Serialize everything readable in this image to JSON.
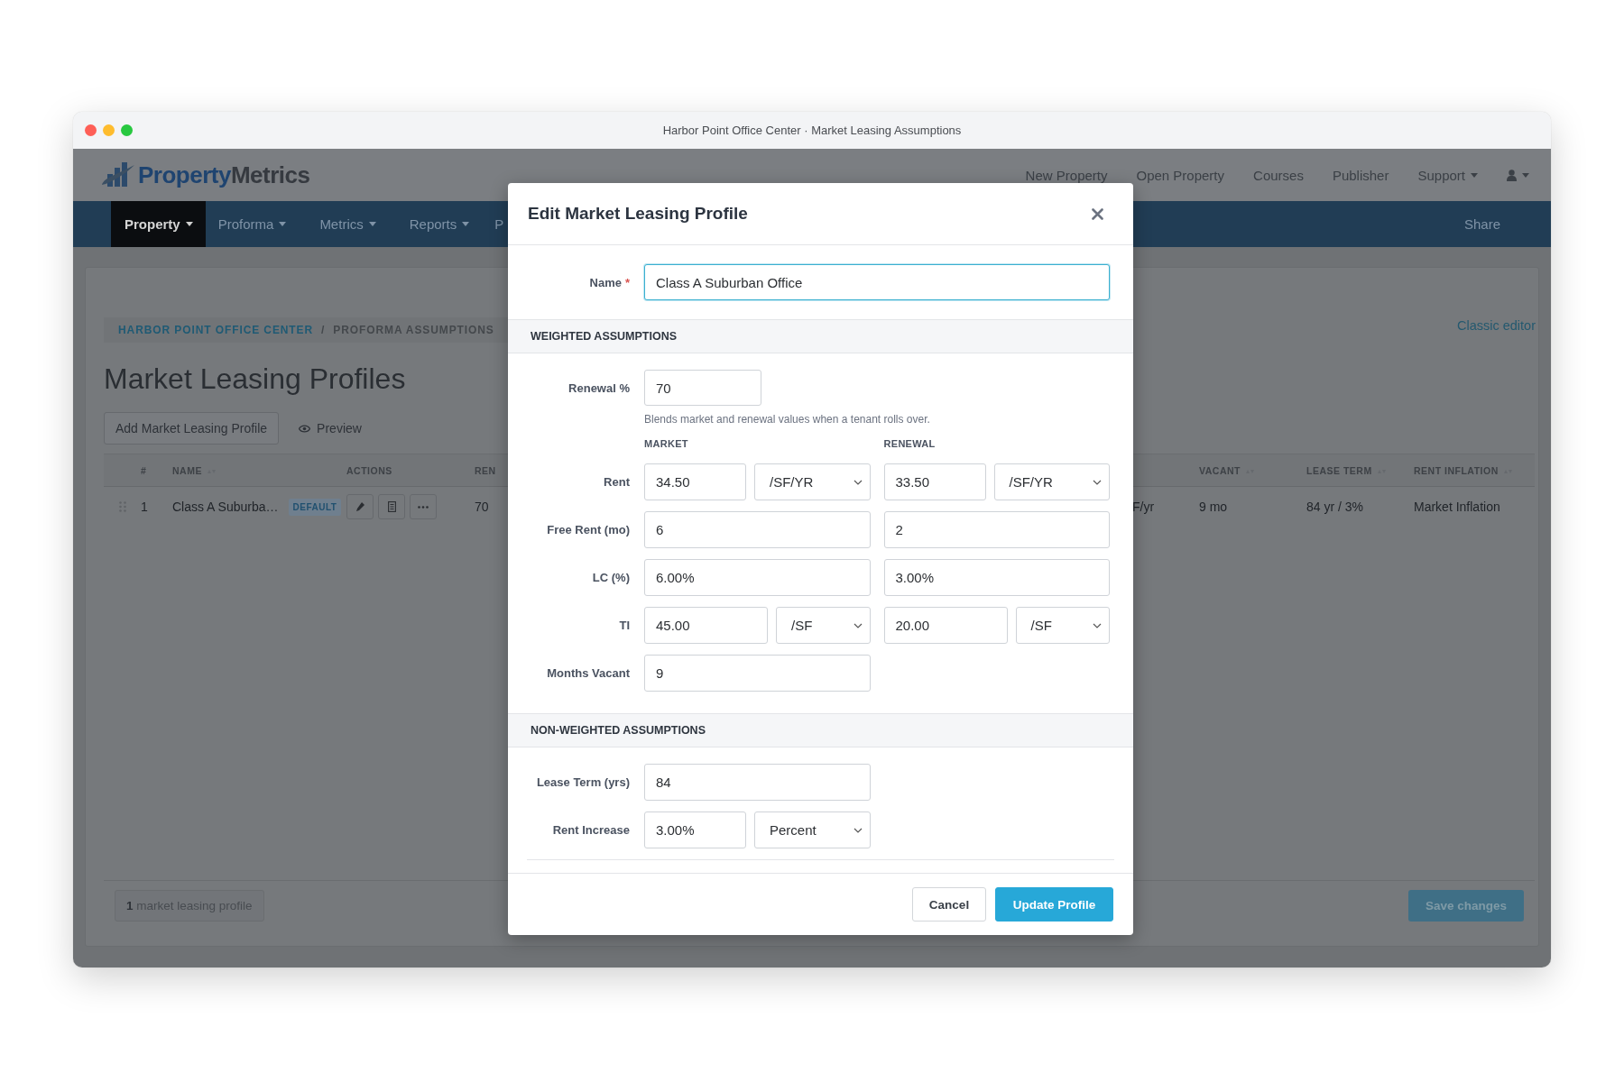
{
  "window": {
    "title": "Harbor Point Office Center · Market Leasing Assumptions"
  },
  "header": {
    "logo_parts": [
      "Property",
      "Metrics"
    ],
    "links": [
      {
        "label": "New Property",
        "dropdown": false
      },
      {
        "label": "Open Property",
        "dropdown": false
      },
      {
        "label": "Courses",
        "dropdown": false
      },
      {
        "label": "Publisher",
        "dropdown": false
      },
      {
        "label": "Support",
        "dropdown": true
      }
    ],
    "user_menu": {
      "dropdown": true
    }
  },
  "nav": {
    "items": [
      {
        "label": "Property",
        "selected": true,
        "dropdown": true
      },
      {
        "label": "Proforma",
        "selected": false,
        "dropdown": true
      },
      {
        "label": "Metrics",
        "selected": false,
        "dropdown": true
      },
      {
        "label": "Reports",
        "selected": false,
        "dropdown": true
      },
      {
        "label": "P",
        "selected": false,
        "dropdown": false
      }
    ],
    "share": "Share"
  },
  "page": {
    "breadcrumb": [
      {
        "label": "HARBOR POINT OFFICE CENTER",
        "kind": "link"
      },
      {
        "label": "/",
        "kind": "separator"
      },
      {
        "label": "PROFORMA ASSUMPTIONS",
        "kind": "current"
      }
    ],
    "classic_editor": "Classic editor",
    "title": "Market Leasing Profiles",
    "add_button": "Add Market Leasing Profile",
    "preview_button": "Preview",
    "table": {
      "columns_left": [
        {
          "label": "#",
          "sortable": false
        },
        {
          "label": "NAME",
          "sortable": true
        },
        {
          "label": "ACTIONS",
          "sortable": false
        },
        {
          "label": "REN"
        }
      ],
      "columns_right": [
        {
          "label": "VACANT",
          "sortable": true
        },
        {
          "label": "LEASE TERM",
          "sortable": true
        },
        {
          "label": "RENT INFLATION",
          "sortable": true
        }
      ],
      "rows": [
        {
          "number": "1",
          "name": "Class A Suburba…",
          "badge": "DEFAULT",
          "renewal": "70",
          "rent_unit": "F/yr",
          "vacant": "9 mo",
          "lease_term": "84 yr / 3%",
          "rent_inflation": "Market Inflation"
        }
      ]
    },
    "count": {
      "number": "1",
      "text": "market leasing profile"
    },
    "save_button": {
      "label": "Save changes",
      "disabled": true
    }
  },
  "modal": {
    "title": "Edit Market Leasing Profile",
    "name_field": {
      "label": "Name",
      "required_mark": "*",
      "value": "Class A Suburban Office",
      "focused": true
    },
    "weighted": {
      "title": "WEIGHTED ASSUMPTIONS",
      "renewal": {
        "label": "Renewal %",
        "value": "70",
        "help": "Blends market and renewal values when a tenant rolls over."
      },
      "column_headings": [
        "MARKET",
        "RENEWAL"
      ],
      "rows": [
        {
          "label": "Rent",
          "kind": "rate",
          "market": {
            "value": "34.50",
            "unit": "/SF/YR"
          },
          "renewal": {
            "value": "33.50",
            "unit": "/SF/YR"
          }
        },
        {
          "label": "Free Rent (mo)",
          "kind": "plain",
          "market": {
            "value": "6"
          },
          "renewal": {
            "value": "2"
          }
        },
        {
          "label": "LC (%)",
          "kind": "plain",
          "market": {
            "value": "6.00%"
          },
          "renewal": {
            "value": "3.00%"
          }
        },
        {
          "label": "TI",
          "kind": "cost",
          "market": {
            "value": "45.00",
            "unit": "/SF"
          },
          "renewal": {
            "value": "20.00",
            "unit": "/SF"
          }
        },
        {
          "label": "Months Vacant",
          "kind": "plain",
          "market": {
            "value": "9"
          }
        }
      ]
    },
    "non_weighted": {
      "title": "NON-WEIGHTED ASSUMPTIONS",
      "rows": [
        {
          "label": "Lease Term (yrs)",
          "kind": "plain",
          "market": {
            "value": "84"
          }
        },
        {
          "label": "Rent Increase",
          "kind": "rate",
          "market": {
            "value": "3.00%",
            "unit": "Percent"
          }
        }
      ]
    },
    "buttons": [
      {
        "label": "Cancel",
        "kind": "secondary"
      },
      {
        "label": "Update Profile",
        "kind": "primary"
      }
    ]
  }
}
